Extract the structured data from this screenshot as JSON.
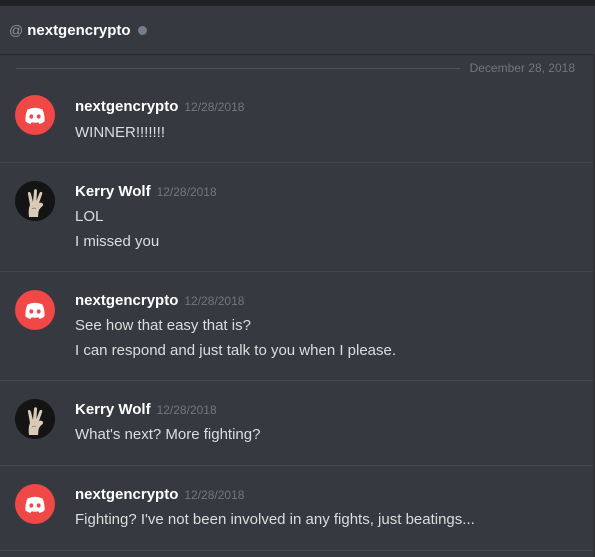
{
  "header": {
    "at_symbol": "@",
    "channel_name": "nextgencrypto"
  },
  "date_divider": "December 28, 2018",
  "messages": [
    {
      "author": "nextgencrypto",
      "timestamp": "12/28/2018",
      "avatar": "discord-logo-icon",
      "lines": [
        "WINNER!!!!!!!"
      ]
    },
    {
      "author": "Kerry Wolf",
      "timestamp": "12/28/2018",
      "avatar": "hand-gesture-avatar",
      "lines": [
        "LOL",
        "I missed you"
      ]
    },
    {
      "author": "nextgencrypto",
      "timestamp": "12/28/2018",
      "avatar": "discord-logo-icon",
      "lines": [
        "See how that easy that is?",
        "I can respond and just talk to you when I please."
      ]
    },
    {
      "author": "Kerry Wolf",
      "timestamp": "12/28/2018",
      "avatar": "hand-gesture-avatar",
      "lines": [
        "What's next? More fighting?"
      ]
    },
    {
      "author": "nextgencrypto",
      "timestamp": "12/28/2018",
      "avatar": "discord-logo-icon",
      "lines": [
        "Fighting?  I've not been involved in any fights, just beatings..."
      ]
    }
  ],
  "colors": {
    "background": "#36393f",
    "discord_red": "#f04747",
    "author": "#ffffff",
    "message_text": "#dcddde",
    "timestamp": "#72767d"
  }
}
